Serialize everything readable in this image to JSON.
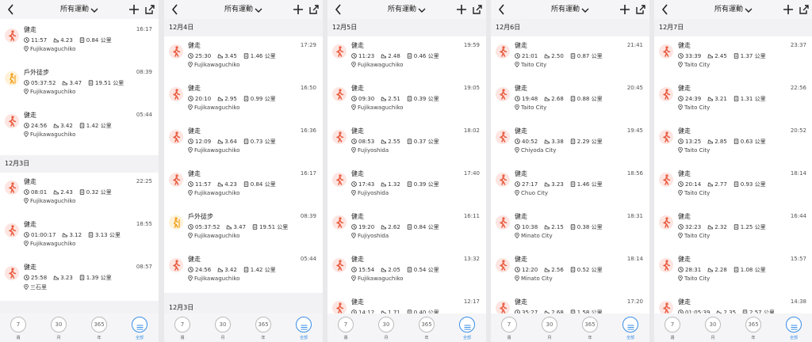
{
  "app": {
    "filter_label": "所有運動",
    "bottom_tabs": [
      {
        "value": "7",
        "label": "週"
      },
      {
        "value": "30",
        "label": "月"
      },
      {
        "value": "365",
        "label": "年"
      },
      {
        "value": "",
        "label": "全部"
      }
    ],
    "active_tab": 3
  },
  "colors": {
    "walk_bg": "#fde5e1",
    "walk_fg": "#ea5c40",
    "hike_bg": "#fff2d8",
    "hike_fg": "#f2a11e",
    "accent": "#3a8ee6"
  },
  "screens": [
    {
      "groups": [
        {
          "date": "",
          "items": [
            {
              "type": "walk",
              "activity": "健走",
              "time": "",
              "duration": "",
              "pace": "",
              "distance": "",
              "location": "Fujikawaguchiko"
            },
            {
              "type": "walk",
              "activity": "健走",
              "time": "16:17",
              "duration": "11:57",
              "pace": "4.23",
              "distance": "0.84 公里",
              "location": "Fujikawaguchiko"
            },
            {
              "type": "hike",
              "activity": "戶外徒步",
              "time": "08:39",
              "duration": "05:37:52",
              "pace": "3.47",
              "distance": "19.51 公里",
              "location": "Fujikawaguchiko"
            },
            {
              "type": "walk",
              "activity": "健走",
              "time": "05:44",
              "duration": "24:56",
              "pace": "3.42",
              "distance": "1.42 公里",
              "location": "Fujikawaguchiko"
            }
          ]
        },
        {
          "date": "12月3日",
          "items": [
            {
              "type": "walk",
              "activity": "健走",
              "time": "22:25",
              "duration": "08:01",
              "pace": "2.43",
              "distance": "0.32 公里",
              "location": "Fujikawaguchiko"
            },
            {
              "type": "walk",
              "activity": "健走",
              "time": "18:55",
              "duration": "01:00:17",
              "pace": "3.12",
              "distance": "3.13 公里",
              "location": "Fujikawaguchiko"
            },
            {
              "type": "walk",
              "activity": "健走",
              "time": "08:57",
              "duration": "25:58",
              "pace": "3.23",
              "distance": "1.39 公里",
              "location": "三石里"
            }
          ]
        }
      ]
    },
    {
      "groups": [
        {
          "date": "12月4日",
          "items": [
            {
              "type": "walk",
              "activity": "健走",
              "time": "17:29",
              "duration": "25:30",
              "pace": "3.45",
              "distance": "1.46 公里",
              "location": "Fujikawaguchiko"
            },
            {
              "type": "walk",
              "activity": "健走",
              "time": "16:50",
              "duration": "20:10",
              "pace": "2.95",
              "distance": "0.99 公里",
              "location": "Fujikawaguchiko"
            },
            {
              "type": "walk",
              "activity": "健走",
              "time": "16:36",
              "duration": "12:09",
              "pace": "3.64",
              "distance": "0.73 公里",
              "location": "Fujikawaguchiko"
            },
            {
              "type": "walk",
              "activity": "健走",
              "time": "16:17",
              "duration": "11:57",
              "pace": "4.23",
              "distance": "0.84 公里",
              "location": "Fujikawaguchiko"
            },
            {
              "type": "hike",
              "activity": "戶外徒步",
              "time": "08:39",
              "duration": "05:37:52",
              "pace": "3.47",
              "distance": "19.51 公里",
              "location": "Fujikawaguchiko"
            },
            {
              "type": "walk",
              "activity": "健走",
              "time": "05:44",
              "duration": "24:56",
              "pace": "3.42",
              "distance": "1.42 公里",
              "location": "Fujikawaguchiko"
            }
          ]
        },
        {
          "date": "12月3日",
          "items": []
        }
      ]
    },
    {
      "groups": [
        {
          "date": "12月5日",
          "items": [
            {
              "type": "walk",
              "activity": "健走",
              "time": "19:59",
              "duration": "11:23",
              "pace": "2.48",
              "distance": "0.46 公里",
              "location": "Fujikawaguchiko"
            },
            {
              "type": "walk",
              "activity": "健走",
              "time": "19:05",
              "duration": "09:30",
              "pace": "2.51",
              "distance": "0.39 公里",
              "location": "Fujikawaguchiko"
            },
            {
              "type": "walk",
              "activity": "健走",
              "time": "18:02",
              "duration": "08:53",
              "pace": "2.55",
              "distance": "0.37 公里",
              "location": "Fujiyoshida"
            },
            {
              "type": "walk",
              "activity": "健走",
              "time": "17:40",
              "duration": "17:43",
              "pace": "1.32",
              "distance": "0.39 公里",
              "location": "Fujiyoshida"
            },
            {
              "type": "walk",
              "activity": "健走",
              "time": "16:11",
              "duration": "19:20",
              "pace": "2.62",
              "distance": "0.84 公里",
              "location": "Fujiyoshida"
            },
            {
              "type": "walk",
              "activity": "健走",
              "time": "13:32",
              "duration": "15:54",
              "pace": "2.05",
              "distance": "0.54 公里",
              "location": "Fujikawaguchiko"
            },
            {
              "type": "walk",
              "activity": "健走",
              "time": "12:17",
              "duration": "14:12",
              "pace": "1.71",
              "distance": "0.40 公里",
              "location": ""
            }
          ]
        }
      ]
    },
    {
      "groups": [
        {
          "date": "12月6日",
          "items": [
            {
              "type": "walk",
              "activity": "健走",
              "time": "21:41",
              "duration": "21:01",
              "pace": "2.50",
              "distance": "0.87 公里",
              "location": "Taito City"
            },
            {
              "type": "walk",
              "activity": "健走",
              "time": "20:45",
              "duration": "19:48",
              "pace": "2.68",
              "distance": "0.88 公里",
              "location": "Taito City"
            },
            {
              "type": "walk",
              "activity": "健走",
              "time": "19:45",
              "duration": "40:52",
              "pace": "3.38",
              "distance": "2.29 公里",
              "location": "Chiyoda City"
            },
            {
              "type": "walk",
              "activity": "健走",
              "time": "18:56",
              "duration": "27:17",
              "pace": "3.23",
              "distance": "1.46 公里",
              "location": "Chuo City"
            },
            {
              "type": "walk",
              "activity": "健走",
              "time": "18:31",
              "duration": "10:38",
              "pace": "2.15",
              "distance": "0.38 公里",
              "location": "Minato City"
            },
            {
              "type": "walk",
              "activity": "健走",
              "time": "18:14",
              "duration": "12:20",
              "pace": "2.56",
              "distance": "0.52 公里",
              "location": "Minato City"
            },
            {
              "type": "walk",
              "activity": "健走",
              "time": "17:20",
              "duration": "35:27",
              "pace": "2.68",
              "distance": "1.58 公里",
              "location": ""
            }
          ]
        }
      ]
    },
    {
      "groups": [
        {
          "date": "12月7日",
          "items": [
            {
              "type": "walk",
              "activity": "健走",
              "time": "23:37",
              "duration": "33:39",
              "pace": "2.45",
              "distance": "1.37 公里",
              "location": "Taito City"
            },
            {
              "type": "walk",
              "activity": "健走",
              "time": "22:56",
              "duration": "24:39",
              "pace": "3.21",
              "distance": "1.31 公里",
              "location": "Taito City"
            },
            {
              "type": "walk",
              "activity": "健走",
              "time": "20:52",
              "duration": "13:25",
              "pace": "2.85",
              "distance": "0.63 公里",
              "location": "Taito City"
            },
            {
              "type": "walk",
              "activity": "健走",
              "time": "18:14",
              "duration": "20:14",
              "pace": "2.77",
              "distance": "0.93 公里",
              "location": "Taito City"
            },
            {
              "type": "walk",
              "activity": "健走",
              "time": "16:44",
              "duration": "32:23",
              "pace": "2.32",
              "distance": "1.25 公里",
              "location": "Taito City"
            },
            {
              "type": "walk",
              "activity": "健走",
              "time": "15:57",
              "duration": "28:31",
              "pace": "2.28",
              "distance": "1.08 公里",
              "location": "Taito City"
            },
            {
              "type": "walk",
              "activity": "健走",
              "time": "14:38",
              "duration": "01:05:39",
              "pace": "2.35",
              "distance": "2.57 公里",
              "location": ""
            }
          ]
        }
      ]
    }
  ]
}
